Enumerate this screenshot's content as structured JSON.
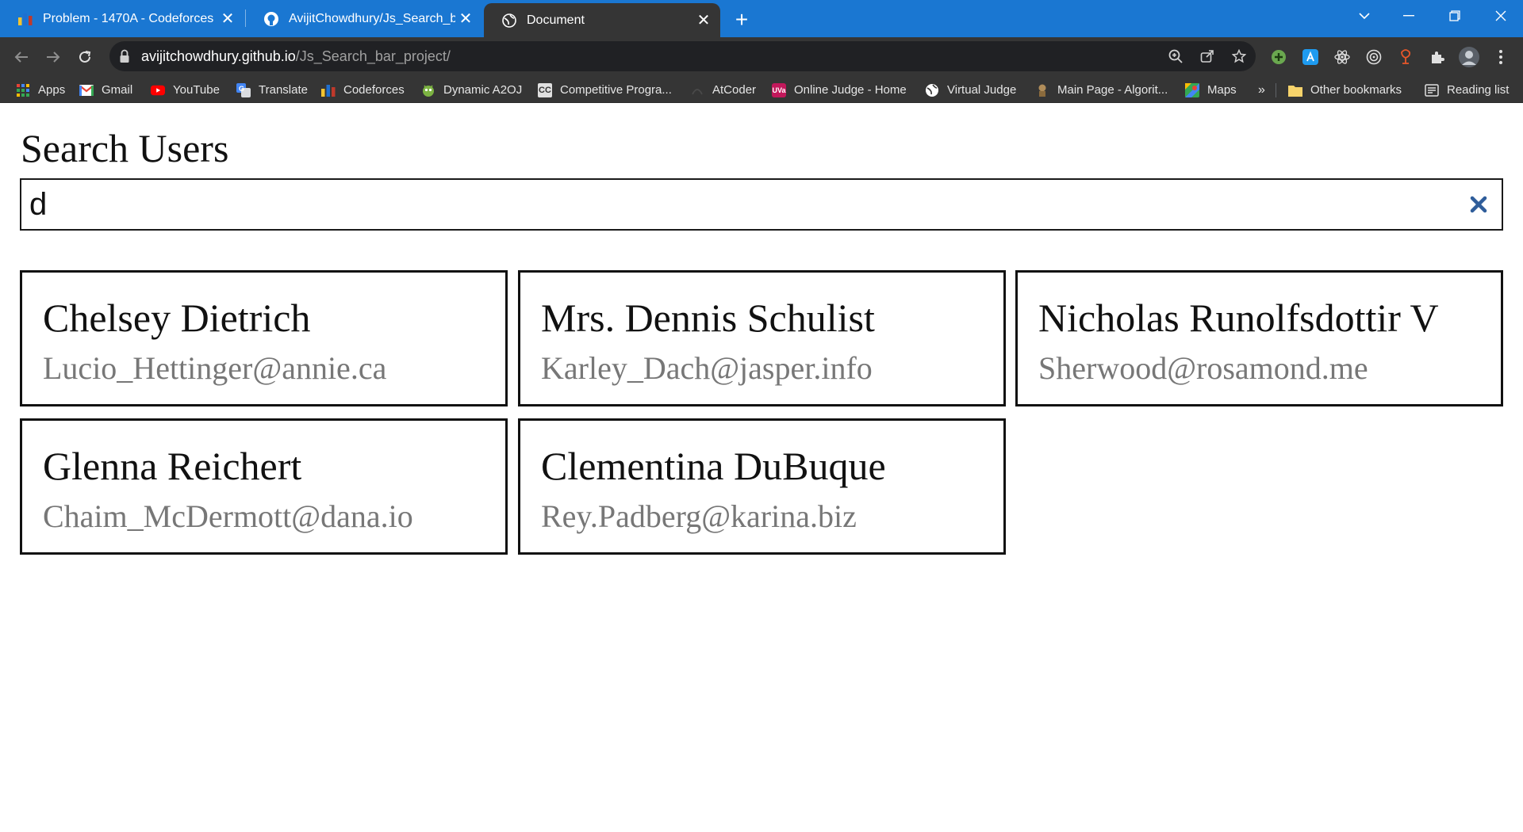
{
  "browser": {
    "tabs": [
      {
        "title": "Problem - 1470A - Codeforces",
        "favicon": "codeforces-icon"
      },
      {
        "title": "AvijitChowdhury/Js_Search_bar_p",
        "favicon": "github-icon"
      },
      {
        "title": "Document",
        "favicon": "globe-icon"
      }
    ],
    "address": {
      "host": "avijitchowdhury.github.io",
      "path": "/Js_Search_bar_project/"
    },
    "bookmarks": [
      {
        "label": "Apps",
        "icon": "apps-grid-icon"
      },
      {
        "label": "Gmail",
        "icon": "gmail-icon"
      },
      {
        "label": "YouTube",
        "icon": "youtube-icon"
      },
      {
        "label": "Translate",
        "icon": "translate-icon"
      },
      {
        "label": "Codeforces",
        "icon": "codeforces-icon"
      },
      {
        "label": "Dynamic A2OJ",
        "icon": "a2oj-icon"
      },
      {
        "label": "Competitive Progra...",
        "icon": "cc-icon"
      },
      {
        "label": "AtCoder",
        "icon": "atcoder-icon"
      },
      {
        "label": "Online Judge - Home",
        "icon": "uva-icon"
      },
      {
        "label": "Virtual Judge",
        "icon": "globe-icon"
      },
      {
        "label": "Main Page - Algorit...",
        "icon": "algorithmist-icon"
      },
      {
        "label": "Maps",
        "icon": "maps-icon"
      }
    ],
    "overflow_label": "»",
    "other_bookmarks": "Other bookmarks",
    "reading_list": "Reading list",
    "colors": {
      "tabstrip": "#1a77d2",
      "toolbar": "#353535"
    }
  },
  "page": {
    "title": "Search Users",
    "search_value": "d",
    "users": [
      {
        "name": "Chelsey Dietrich",
        "email": "Lucio_Hettinger@annie.ca"
      },
      {
        "name": "Mrs. Dennis Schulist",
        "email": "Karley_Dach@jasper.info"
      },
      {
        "name": "Nicholas Runolfsdottir V",
        "email": "Sherwood@rosamond.me"
      },
      {
        "name": "Glenna Reichert",
        "email": "Chaim_McDermott@dana.io"
      },
      {
        "name": "Clementina DuBuque",
        "email": "Rey.Padberg@karina.biz"
      }
    ],
    "colors": {
      "clear_icon": "#2f5d9a",
      "email": "#777777"
    }
  }
}
